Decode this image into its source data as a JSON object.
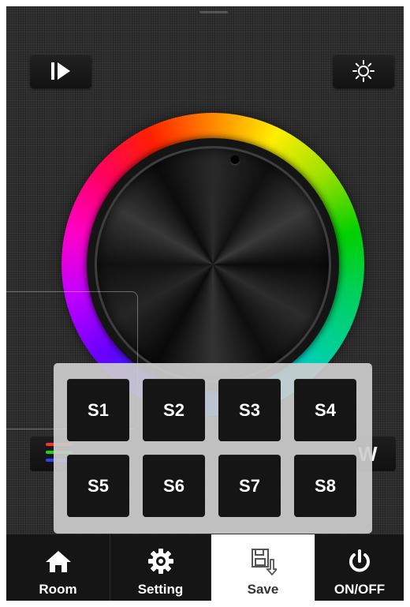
{
  "toolbar": {
    "play_icon": "play-skip-icon",
    "light_icon": "brightness-sun-icon"
  },
  "color_wheel": {
    "knob_icon": "color-selector-dot"
  },
  "channels": {
    "rgb_icon": "rgb-lines-icon",
    "rgb_colors": [
      "#ff3030",
      "#20d020",
      "#3040ff"
    ],
    "white_label": "W"
  },
  "scenes": {
    "buttons": [
      "S1",
      "S2",
      "S3",
      "S4",
      "S5",
      "S6",
      "S7",
      "S8"
    ]
  },
  "tabbar": {
    "room_label": "Room",
    "setting_label": "Setting",
    "save_label": "Save",
    "onoff_label": "ON/OFF",
    "active_tab": "Save"
  }
}
